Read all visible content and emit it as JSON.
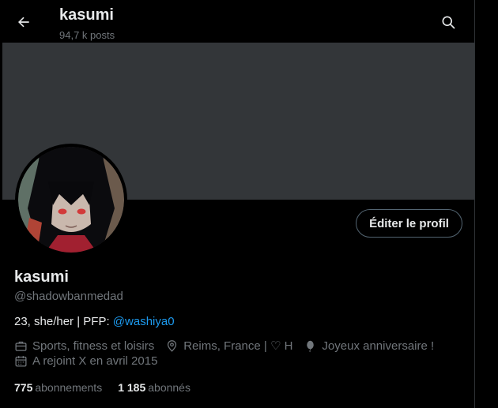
{
  "header": {
    "title": "kasumi",
    "post_count": "94,7 k posts"
  },
  "profile": {
    "edit_button": "Éditer le profil",
    "display_name": "kasumi",
    "handle": "@shadowbanmedad",
    "bio_prefix": "23, she/her | PFP: ",
    "bio_mention": "@washiya0",
    "category": "Sports, fitness et loisirs",
    "location": "Reims, France | ♡ H",
    "birthday": "Joyeux anniversaire !",
    "joined": "A rejoint X en avril 2015"
  },
  "stats": {
    "following_count": "775",
    "following_label": "abonnements",
    "followers_count": "1 185",
    "followers_label": "abonnés"
  },
  "colors": {
    "background": "#000000",
    "banner": "#333639",
    "text": "#e7e9ea",
    "muted": "#71767b",
    "accent": "#1d9bf0"
  }
}
